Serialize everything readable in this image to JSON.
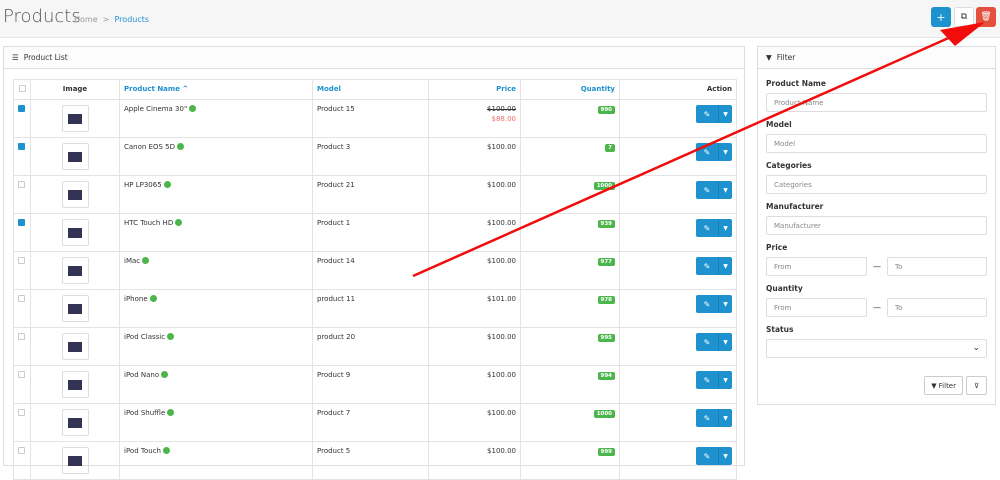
{
  "header": {
    "title": "Products",
    "breadcrumb": [
      "Home",
      "Products"
    ],
    "add_icon": "plus-icon",
    "copy_icon": "copy-icon",
    "delete_icon": "trash-icon",
    "accent": "#1e91cf",
    "danger": "#e3503e"
  },
  "list": {
    "title": "Product List",
    "columns": {
      "image": "Image",
      "name": "Product Name ^",
      "model": "Model",
      "price": "Price",
      "quantity": "Quantity",
      "action": "Action"
    },
    "rows": [
      {
        "checked": true,
        "name": "Apple Cinema 30\"",
        "model": "Product 15",
        "price": "$100.00",
        "special": "$88.00",
        "quantity": "990"
      },
      {
        "checked": true,
        "name": "Canon EOS 5D",
        "model": "Product 3",
        "price": "$100.00",
        "quantity": "7"
      },
      {
        "checked": false,
        "name": "HP LP3065",
        "model": "Product 21",
        "price": "$100.00",
        "quantity": "1000"
      },
      {
        "checked": true,
        "name": "HTC Touch HD",
        "model": "Product 1",
        "price": "$100.00",
        "quantity": "939"
      },
      {
        "checked": false,
        "name": "iMac",
        "model": "Product 14",
        "price": "$100.00",
        "quantity": "977"
      },
      {
        "checked": false,
        "name": "iPhone",
        "model": "product 11",
        "price": "$101.00",
        "quantity": "978"
      },
      {
        "checked": false,
        "name": "iPod Classic",
        "model": "product 20",
        "price": "$100.00",
        "quantity": "995"
      },
      {
        "checked": false,
        "name": "iPod Nano",
        "model": "Product 9",
        "price": "$100.00",
        "quantity": "994"
      },
      {
        "checked": false,
        "name": "iPod Shuffle",
        "model": "Product 7",
        "price": "$100.00",
        "quantity": "1000"
      },
      {
        "checked": false,
        "name": "iPod Touch",
        "model": "Product 5",
        "price": "$100.00",
        "quantity": "999"
      }
    ]
  },
  "filter": {
    "title": "Filter",
    "product_name": {
      "label": "Product Name",
      "placeholder": "Product Name"
    },
    "model": {
      "label": "Model",
      "placeholder": "Model"
    },
    "categories": {
      "label": "Categories",
      "placeholder": "Categories"
    },
    "manufacturer": {
      "label": "Manufacturer",
      "placeholder": "Manufacturer"
    },
    "price": {
      "label": "Price",
      "from": "From",
      "to": "To"
    },
    "quantity": {
      "label": "Quantity",
      "from": "From",
      "to": "To"
    },
    "status": {
      "label": "Status",
      "value": ""
    },
    "filter_button": "Filter"
  }
}
